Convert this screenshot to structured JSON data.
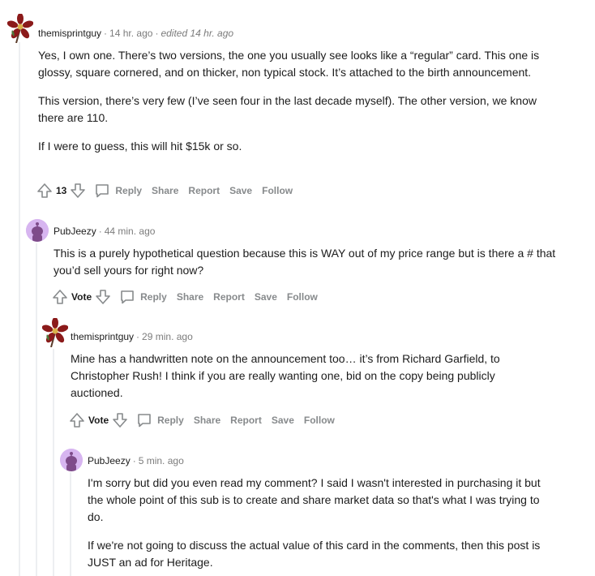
{
  "comments": [
    {
      "author": "themisprintguy",
      "time": "14 hr. ago",
      "edited": "edited 14 hr. ago",
      "paragraphs": [
        "Yes, I own one. There’s two versions, the one you usually see looks like a “regular” card. This one is glossy, square cornered, and on thicker, non typical stock. It’s attached to the birth announcement.",
        "This version, there’s very few (I’ve seen four in the last decade myself). The other version, we know there are 110.",
        "If I were to guess, this will hit $15k or so."
      ],
      "votes": "13",
      "actions": {
        "reply": "Reply",
        "share": "Share",
        "report": "Report",
        "save": "Save",
        "follow": "Follow"
      }
    },
    {
      "author": "PubJeezy",
      "time": "44 min. ago",
      "paragraphs": [
        "This is a purely hypothetical question because this is WAY out of my price range but is there a # that you’d sell yours for right now?"
      ],
      "votes": "Vote",
      "actions": {
        "reply": "Reply",
        "share": "Share",
        "report": "Report",
        "save": "Save",
        "follow": "Follow"
      }
    },
    {
      "author": "themisprintguy",
      "time": "29 min. ago",
      "paragraphs": [
        "Mine has a handwritten note on the announcement too… it’s from Richard Garfield, to Christopher Rush! I think if you are really wanting one, bid on the copy being publicly auctioned."
      ],
      "votes": "Vote",
      "actions": {
        "reply": "Reply",
        "share": "Share",
        "report": "Report",
        "save": "Save",
        "follow": "Follow"
      }
    },
    {
      "author": "PubJeezy",
      "time": "5 min. ago",
      "paragraphs": [
        "I'm sorry but did you even read my comment? I said I wasn't interested in purchasing it but the whole point of this sub is to create and share market data so that's what I was trying to do.",
        "If we're not going to discuss the actual value of this card in the comments, then this post is JUST an ad for Heritage."
      ]
    }
  ],
  "colors": {
    "meta_gray": "#7c7c7c",
    "action_gray": "#878a8c",
    "thread_line": "#edeff1",
    "snoo_avatar_bg": "#d7b5f0",
    "flower_red": "#8b1a1a"
  }
}
